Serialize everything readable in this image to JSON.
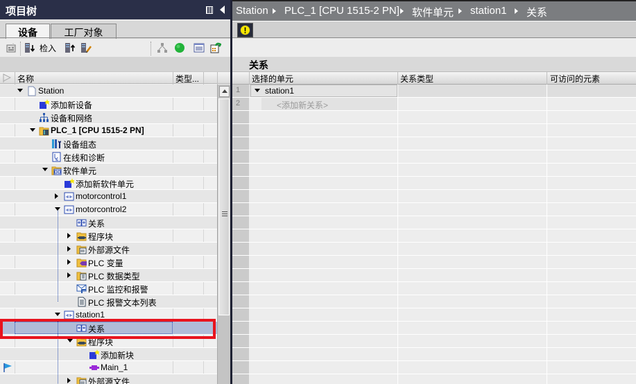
{
  "left_panel": {
    "title": "项目树",
    "tabs": [
      {
        "label": "设备",
        "active": true
      },
      {
        "label": "工厂对象",
        "active": false
      }
    ],
    "toolbar": {
      "checkin_label": "检入"
    },
    "columns": {
      "name": "名称",
      "type": "类型..."
    },
    "tree": [
      {
        "label": "Station",
        "level": 0,
        "expander": "open",
        "icon": "station-document-icon"
      },
      {
        "label": "添加新设备",
        "level": 1,
        "expander": "none",
        "icon": "add-new-device-icon"
      },
      {
        "label": "设备和网络",
        "level": 1,
        "expander": "none",
        "icon": "devices-networks-icon"
      },
      {
        "label": "PLC_1 [CPU 1515-2 PN]",
        "level": 1,
        "expander": "open",
        "icon": "plc-folder-icon",
        "bold": true
      },
      {
        "label": "设备组态",
        "level": 2,
        "expander": "none",
        "icon": "device-config-icon"
      },
      {
        "label": "在线和诊断",
        "level": 2,
        "expander": "none",
        "icon": "online-diagnostics-icon"
      },
      {
        "label": "软件单元",
        "level": 2,
        "expander": "open",
        "icon": "software-units-folder-icon"
      },
      {
        "label": "添加新软件单元",
        "level": 3,
        "expander": "none",
        "icon": "add-new-software-unit-icon"
      },
      {
        "label": "motorcontrol1",
        "level": 3,
        "expander": "closed",
        "icon": "software-unit-icon"
      },
      {
        "label": "motorcontrol2",
        "level": 3,
        "expander": "open",
        "icon": "software-unit-icon"
      },
      {
        "label": "关系",
        "level": 4,
        "expander": "none",
        "icon": "relations-icon"
      },
      {
        "label": "程序块",
        "level": 4,
        "expander": "closed",
        "icon": "program-blocks-folder-icon"
      },
      {
        "label": "外部源文件",
        "level": 4,
        "expander": "closed",
        "icon": "external-source-folder-icon"
      },
      {
        "label": "PLC 变量",
        "level": 4,
        "expander": "closed",
        "icon": "plc-tags-folder-icon"
      },
      {
        "label": "PLC 数据类型",
        "level": 4,
        "expander": "closed",
        "icon": "plc-datatypes-folder-icon"
      },
      {
        "label": "PLC 监控和报警",
        "level": 4,
        "expander": "none",
        "icon": "plc-supervision-icon"
      },
      {
        "label": "PLC 报警文本列表",
        "level": 4,
        "expander": "none",
        "icon": "plc-alarm-text-icon"
      },
      {
        "label": "station1",
        "level": 3,
        "expander": "open",
        "icon": "software-unit-icon"
      },
      {
        "label": "关系",
        "level": 4,
        "expander": "none",
        "icon": "relations-icon",
        "selected": true
      },
      {
        "label": "程序块",
        "level": 4,
        "expander": "open",
        "icon": "program-blocks-folder-icon"
      },
      {
        "label": "添加新块",
        "level": 5,
        "expander": "none",
        "icon": "add-new-block-icon"
      },
      {
        "label": "Main_1",
        "level": 5,
        "expander": "none",
        "icon": "ob-block-icon",
        "flag": true
      },
      {
        "label": "外部源文件",
        "level": 4,
        "expander": "closed",
        "icon": "external-source-folder-icon"
      }
    ]
  },
  "right_panel": {
    "breadcrumb": [
      "Station",
      "PLC_1 [CPU 1515-2 PN]",
      "软件单元",
      "station1",
      "关系"
    ],
    "section_title": "关系",
    "columns": [
      "选择的单元",
      "关系类型",
      "可访问的元素"
    ],
    "rows": [
      {
        "num": "1",
        "unit": "station1",
        "relation_type": "",
        "elements": ""
      },
      {
        "num": "2",
        "unit": "<添加新关系>",
        "relation_type": "",
        "elements": ""
      }
    ]
  },
  "colors": {
    "title_bar": "#2a2f48",
    "breadcrumb_bar": "#7b7d80",
    "selection": "#b0bcd8",
    "highlight_box": "#e8141e",
    "warning": "#f6e600"
  }
}
